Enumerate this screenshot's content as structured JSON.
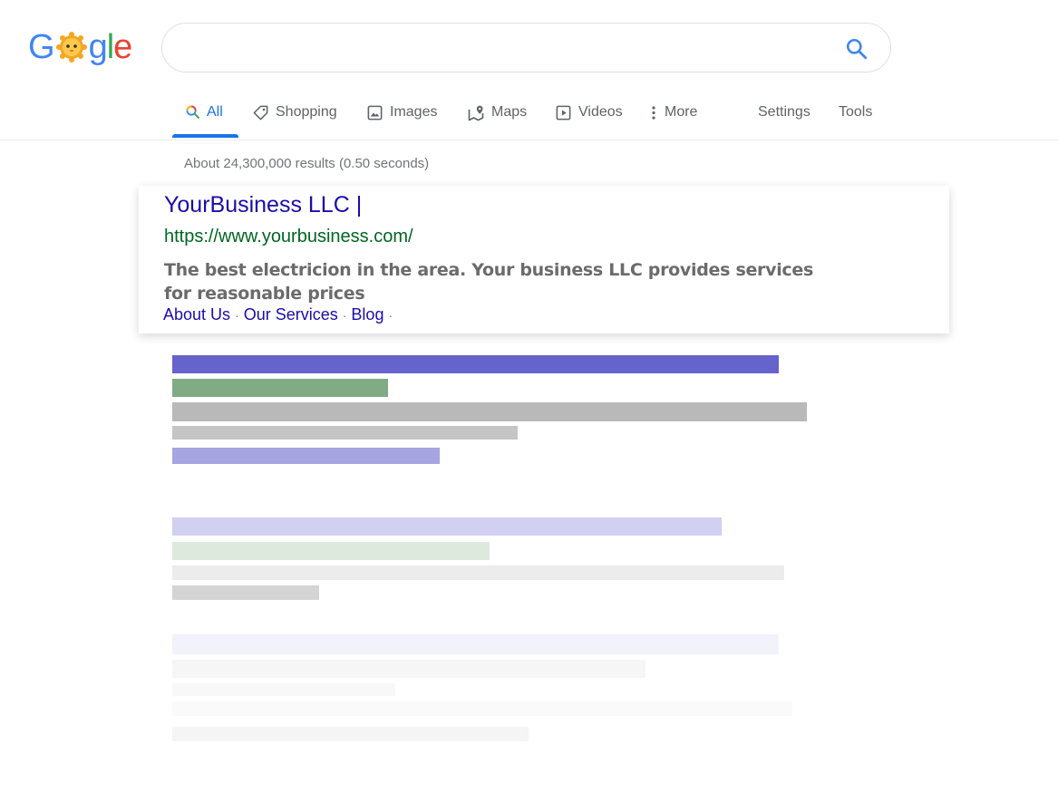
{
  "logo": {
    "letters": [
      "G",
      "o",
      "o",
      "g",
      "l",
      "e"
    ],
    "colors": [
      "#4285f4",
      "#ea4335",
      "#fbbc05",
      "#4285f4",
      "#34a853",
      "#ea4335"
    ]
  },
  "search": {
    "value": "",
    "placeholder": ""
  },
  "tabs": [
    {
      "label": "All",
      "icon": "search-icon"
    },
    {
      "label": "Shopping",
      "icon": "tag-icon"
    },
    {
      "label": "Images",
      "icon": "image-icon"
    },
    {
      "label": "Maps",
      "icon": "map-icon"
    },
    {
      "label": "Videos",
      "icon": "play-icon"
    },
    {
      "label": "More",
      "icon": "more-vert-icon"
    }
  ],
  "tools": {
    "settings": "Settings",
    "tools": "Tools"
  },
  "result_stats": "About 24,300,000 results (0.50 seconds)",
  "result": {
    "title": "YourBusiness LLC |",
    "url": "https://www.yourbusiness.com/",
    "description": "The best electricion in the area. Your business LLC provides services for reasonable prices",
    "sitelinks": [
      "About Us",
      "Our Services",
      "Blog"
    ]
  },
  "colors": {
    "link": "#1a0dab",
    "url": "#006621",
    "accent": "#1a73e8"
  }
}
